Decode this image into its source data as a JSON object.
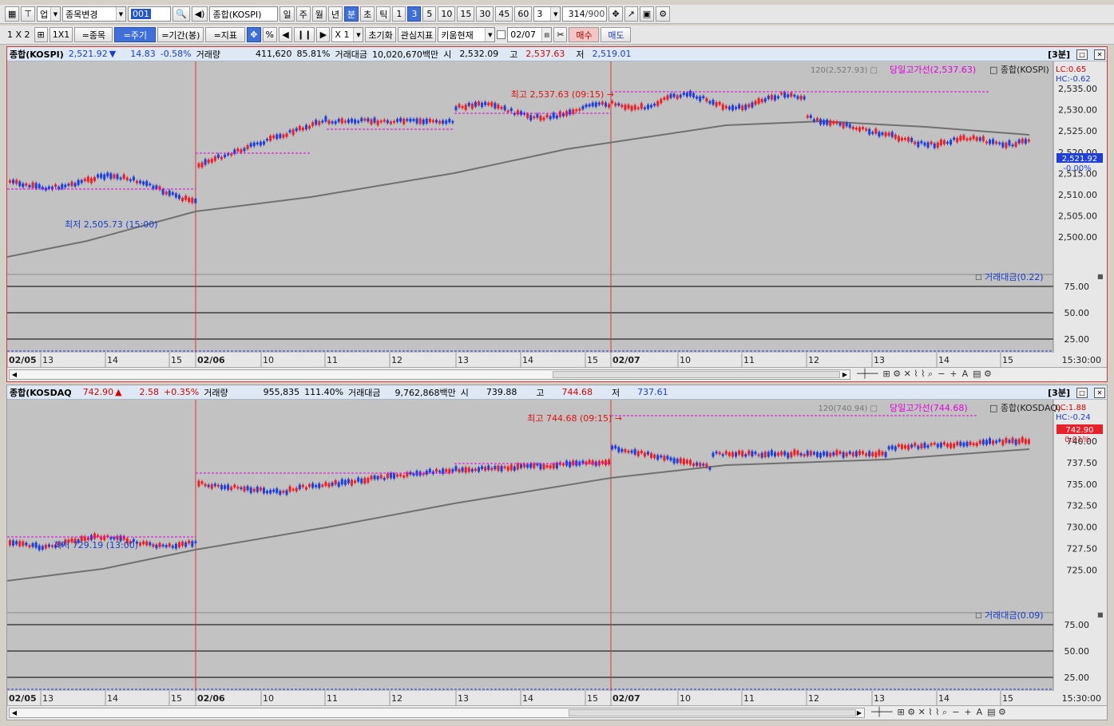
{
  "toolbar1": {
    "market_select": "업",
    "stock_change": "종목변경",
    "code_input": "001",
    "index_name": "종합(KOSPI)",
    "period_buttons": [
      "일",
      "주",
      "월",
      "년",
      "분",
      "초",
      "틱"
    ],
    "period_selected": "분",
    "minute_buttons": [
      "1",
      "3",
      "5",
      "10",
      "15",
      "30",
      "45",
      "60"
    ],
    "minute_selected": "3",
    "minute_combo": "3",
    "count": "314",
    "count_max": "/900"
  },
  "toolbar2": {
    "layout_1x2": "1 X 2",
    "layout_1x1": "1X1",
    "btn_stock": "=종목",
    "btn_period": "=주기",
    "btn_range": "=기간(봉)",
    "btn_indicator": "=지표",
    "zoom": "X 1",
    "reset": "초기화",
    "watch_indicator": "관심지표",
    "kiwoom_current": "키움현재",
    "date": "02/07",
    "buy": "매수",
    "sell": "매도"
  },
  "pane1": {
    "name": "종합(KOSPI)",
    "price": "2,521.92",
    "arrow": "▼",
    "change": "14.83",
    "change_pct": "-0.58%",
    "vol_label": "거래량",
    "volume": "411,620",
    "vol_pct": "85.81%",
    "amt_label": "거래대금",
    "amount": "10,020,670백만",
    "open_label": "시",
    "open": "2,532.09",
    "high_label": "고",
    "high": "2,537.63",
    "low_label": "저",
    "low": "2,519.01",
    "period_tag": "[3분]",
    "ma_label": "120(2,527.93)",
    "hl_label": "당일고가선(2,537.63)",
    "legend_name": "종합(KOSPI)",
    "lc": "LC:0.65",
    "hc": "HC:-0.62",
    "last_box": "2,521.92",
    "last_pct": "-0.00%",
    "high_annot": "최고 2,537.63 (09:15)",
    "low_annot": "최저 2,505.73 (15:00)",
    "sub_label": "거래대금(0.22)",
    "price_ticks": [
      "2,535.00",
      "2,530.00",
      "2,525.00",
      "2,520.00",
      "2,515.00",
      "2,510.00",
      "2,505.00",
      "2,500.00"
    ],
    "sub_ticks": [
      "75.00",
      "50.00",
      "25.00"
    ],
    "time_labels": [
      "02/05",
      "13",
      "14",
      "15",
      "02/06",
      "10",
      "11",
      "12",
      "13",
      "14",
      "15",
      "02/07",
      "10",
      "11",
      "12",
      "13",
      "14",
      "15"
    ],
    "time_right": "15:30:00"
  },
  "pane2": {
    "name": "종합(KOSDAQ",
    "price": "742.90",
    "arrow": "▲",
    "change": "2.58",
    "change_pct": "+0.35%",
    "vol_label": "거래량",
    "volume": "955,835",
    "vol_pct": "111.40%",
    "amt_label": "거래대금",
    "amount": "9,762,868백만",
    "open_label": "시",
    "open": "739.88",
    "high_label": "고",
    "high": "744.68",
    "low_label": "저",
    "low": "737.61",
    "period_tag": "[3분]",
    "ma_label": "120(740.94)",
    "hl_label": "당일고가선(744.68)",
    "legend_name": "종합(KOSDAQ)",
    "lc": "LC:1.88",
    "hc": "HC:-0.24",
    "last_box": "742.90",
    "last_pct": "0.01%",
    "high_annot": "최고 744.68 (09:15)",
    "low_annot": "최저 729.19 (13:00)",
    "sub_label": "거래대금(0.09)",
    "price_ticks": [
      "740.00",
      "737.50",
      "735.00",
      "732.50",
      "730.00",
      "727.50",
      "725.00"
    ],
    "sub_ticks": [
      "75.00",
      "50.00",
      "25.00"
    ],
    "time_labels": [
      "02/05",
      "13",
      "14",
      "15",
      "02/06",
      "10",
      "11",
      "12",
      "13",
      "14",
      "15",
      "02/07",
      "10",
      "11",
      "12",
      "13",
      "14",
      "15"
    ],
    "time_right": "15:30:00"
  },
  "colors": {
    "up": "#e8202a",
    "down": "#1f3fd6",
    "ma": "#707070",
    "hl": "#e000e0"
  }
}
